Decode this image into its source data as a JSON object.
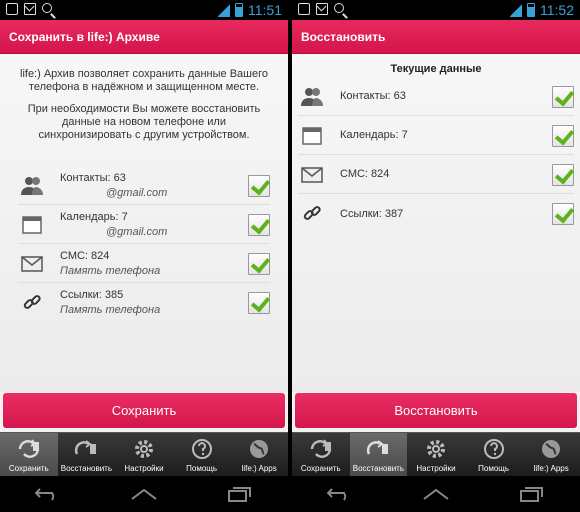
{
  "status": {
    "time": "11:51",
    "time_right": "11:52"
  },
  "left": {
    "title": "Сохранить в life:) Архиве",
    "intro_1": "life:) Архив позволяет сохранить данные Вашего телефона в надёжном и защищенном месте.",
    "intro_2": "При необходимости Вы можете восстановить данные на новом телефоне или синхронизировать с другим устройством.",
    "items": [
      {
        "label": "Контакты: 63",
        "sub": "@gmail.com",
        "icon": "contacts-icon",
        "checked": true
      },
      {
        "label": "Календарь: 7",
        "sub": "@gmail.com",
        "icon": "calendar-icon",
        "checked": true
      },
      {
        "label": "СМС: 824",
        "sub": "Память телефона",
        "icon": "mail-icon",
        "checked": true
      },
      {
        "label": "Ссылки: 385",
        "sub": "Память телефона",
        "icon": "link-icon",
        "checked": true
      }
    ],
    "action": "Сохранить"
  },
  "right": {
    "title": "Восстановить",
    "section": "Текущие данные",
    "items": [
      {
        "label": "Контакты: 63",
        "icon": "contacts-icon",
        "checked": true
      },
      {
        "label": "Календарь: 7",
        "icon": "calendar-icon",
        "checked": true
      },
      {
        "label": "СМС: 824",
        "icon": "mail-icon",
        "checked": true
      },
      {
        "label": "Ссылки: 387",
        "icon": "link-icon",
        "checked": true
      }
    ],
    "action": "Восстановить"
  },
  "tabs": [
    "Сохранить",
    "Восстановить",
    "Настройки",
    "Помощь",
    "life:) Apps"
  ],
  "colors": {
    "accent": "#e0225a",
    "check": "#5cb31b",
    "status_blue": "#35a3d8"
  }
}
